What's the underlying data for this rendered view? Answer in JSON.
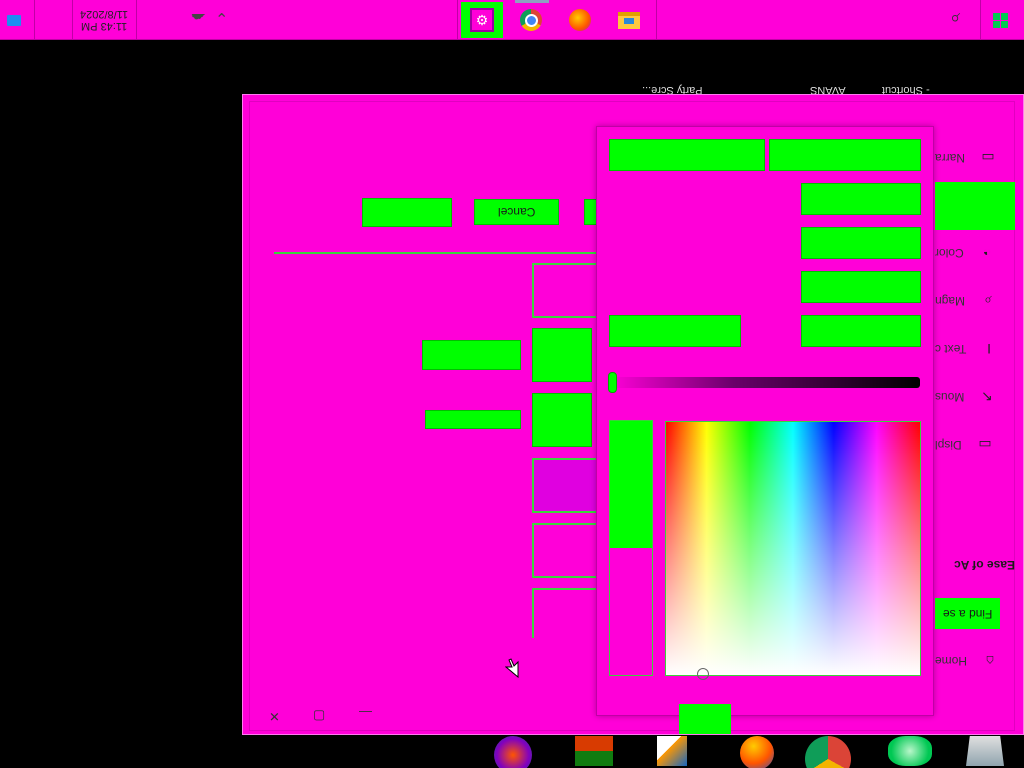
{
  "taskbar": {
    "clock_time": "11:43 PM",
    "clock_date": "11/8/2024",
    "pinned": [
      {
        "name": "settings-icon",
        "glyph": "⚙",
        "active": true
      },
      {
        "name": "chrome-icon",
        "glyph": "◉"
      },
      {
        "name": "firefox-icon",
        "glyph": "◍"
      },
      {
        "name": "file-explorer-icon",
        "glyph": "▰"
      }
    ],
    "start_glyph": "⊞",
    "search_glyph": "⌕",
    "tray_chevron": "⌄"
  },
  "desktop": {
    "labels": [
      "- Shortcut",
      "AVANS",
      "Party Scre..."
    ]
  },
  "window": {
    "caption": {
      "minimize": "—",
      "maximize": "▢",
      "close": "✕"
    },
    "sidebar": {
      "home": "Home",
      "search": "Find a se",
      "section": "Ease of Ac",
      "items": [
        {
          "label": "Narra",
          "icon": "narrator-icon",
          "glyph": "▭"
        },
        {
          "label": "Color",
          "icon": "color-filter-icon",
          "glyph": "◔"
        },
        {
          "label": "Magn",
          "icon": "magnifier-icon",
          "glyph": "⌕"
        },
        {
          "label": "Text c",
          "icon": "text-cursor-icon",
          "glyph": "I"
        },
        {
          "label": "Mous",
          "icon": "mouse-pointer-icon",
          "glyph": "↖"
        },
        {
          "label": "Displ",
          "icon": "display-icon",
          "glyph": "▭"
        }
      ]
    },
    "content": {
      "cancel_label": "Cancel"
    }
  },
  "colors": {
    "background": "#ff00d8",
    "accent": "#00ff00",
    "desktop": "#000000"
  },
  "dock": {
    "icons": [
      "app-icon-1",
      "app-icon-2",
      "app-icon-3",
      "app-icon-4",
      "chrome-icon",
      "app-icon-6",
      "app-icon-7"
    ]
  }
}
